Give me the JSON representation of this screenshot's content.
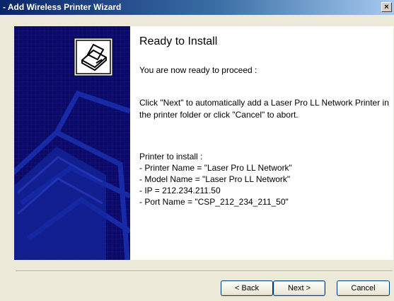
{
  "window": {
    "title": "- Add Wireless Printer Wizard",
    "close_label": "×"
  },
  "content": {
    "heading": "Ready to Install",
    "intro": "You are now ready to proceed :",
    "instruction": "Click \"Next\" to automatically add a Laser Pro LL Network Printer in the printer folder or click \"Cancel\" to abort.",
    "details_label": "Printer to install :",
    "details": [
      "- Printer Name = \"Laser Pro LL Network\"",
      "- Model Name = \"Laser Pro LL Network\"",
      "- IP = 212.234.211.50",
      "- Port Name = \"CSP_212_234_211_50\""
    ]
  },
  "buttons": {
    "back": "< Back",
    "next": "Next >",
    "cancel": "Cancel"
  },
  "icons": {
    "wizard": "printer-icon",
    "close": "close-icon"
  },
  "colors": {
    "panel_blue": "#08085a",
    "titlebar": "#0a246a"
  }
}
